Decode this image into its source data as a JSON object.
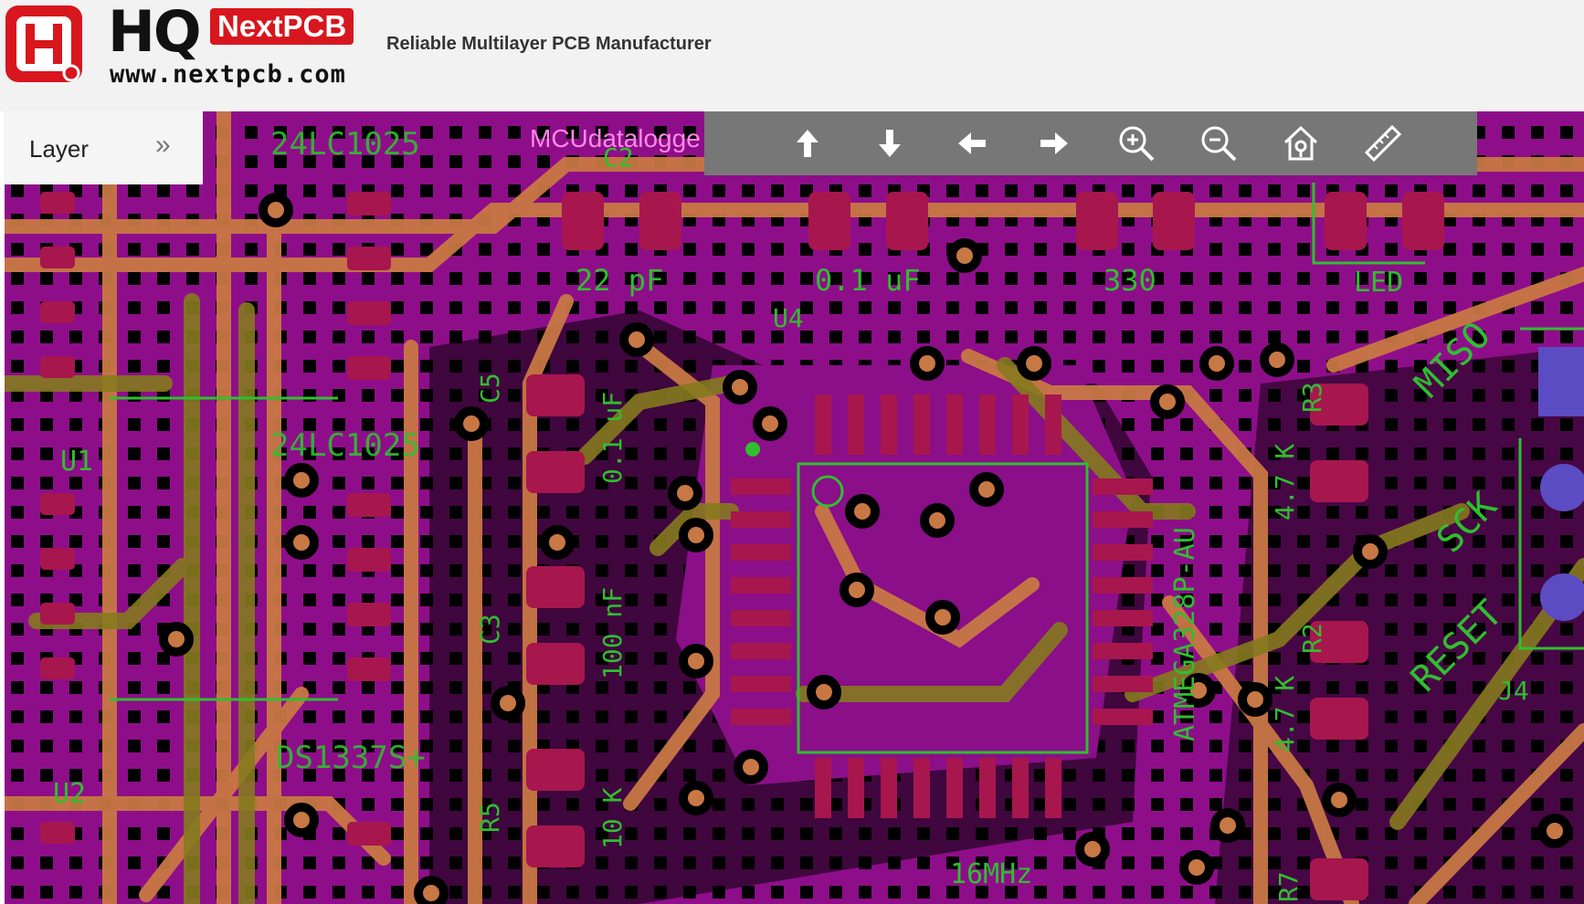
{
  "header": {
    "logo_text": "HQ",
    "brand_badge": "NextPCB",
    "url": "www.nextpcb.com",
    "tagline": "Reliable Multilayer PCB Manufacturer"
  },
  "layer_panel": {
    "label": "Layer",
    "expand_icon": "»"
  },
  "board_title": "MCUdatalogge",
  "toolbar": {
    "tools": [
      "arrow-up-icon",
      "arrow-down-icon",
      "arrow-left-icon",
      "arrow-right-icon",
      "zoom-in-icon",
      "zoom-out-icon",
      "home-icon",
      "ruler-icon"
    ]
  },
  "silkscreen": {
    "u1_chip_top": "24LC1025",
    "u1_chip_mid": "24LC1025",
    "u1_ref": "U1",
    "u2_chip": "DS1337S+",
    "u2_ref": "U2",
    "c2_ref": "C2",
    "c2_value": "22 pF",
    "cap2_value": "0.1 uF",
    "res_value": "330",
    "led_label": "LED",
    "u4_ref": "U4",
    "c5_ref": "C5",
    "c5_value": "0.1 uF",
    "c3_ref": "C3",
    "c3_value": "100 nF",
    "r5_ref": "R5",
    "r5_value": "10 K",
    "mcu": "ATMEGA328P-AU",
    "r3_ref": "R3",
    "r3_value": "4.7 K",
    "r2_ref": "R2",
    "r2_value": "4.7 K",
    "r7_ref": "R7",
    "miso": "MISO",
    "sck": "SCK",
    "reset": "RESET",
    "j4_ref": "J4",
    "crystal": "16MHz"
  },
  "colors": {
    "board_black": "#000000",
    "copper_magenta": "#8e0e8a",
    "trace_orange": "#c87844",
    "trace_olive": "#857a1e",
    "pad_crimson": "#a8164e",
    "silk_green": "#2fbf2f",
    "toolbar_gray": "#777777",
    "brand_red": "#d8161e"
  }
}
